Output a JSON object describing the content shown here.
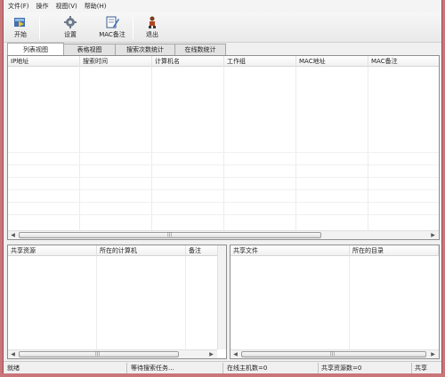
{
  "menubar": {
    "items": [
      "文件(F)",
      "操作",
      "视图(V)",
      "帮助(H)"
    ]
  },
  "toolbar": {
    "start": "开始",
    "settings": "设置",
    "mac_note": "MAC备注",
    "exit": "退出"
  },
  "tabs": [
    "列表视图",
    "表格视图",
    "搜索次数统计",
    "在线数统计"
  ],
  "main_table": {
    "columns": [
      "IP地址",
      "搜索时间",
      "计算机名",
      "工作组",
      "MAC地址",
      "MAC备注"
    ]
  },
  "share_table": {
    "columns": [
      "共享资源",
      "所在的计算机",
      "备注"
    ]
  },
  "file_table": {
    "columns": [
      "共享文件",
      "所在的目录"
    ]
  },
  "statusbar": {
    "ready": "就绪",
    "waiting": "等待搜索任务...",
    "online_hosts": "在线主机数=0",
    "share_count": "共享资源数=0",
    "share_files": "共享"
  },
  "icons": {
    "start": "play-icon",
    "settings": "gear-icon",
    "mac_note": "edit-note-icon",
    "exit": "exit-person-icon"
  },
  "colors": {
    "window_border": "#c9767b",
    "panel_bg": "#f0f0f0"
  }
}
